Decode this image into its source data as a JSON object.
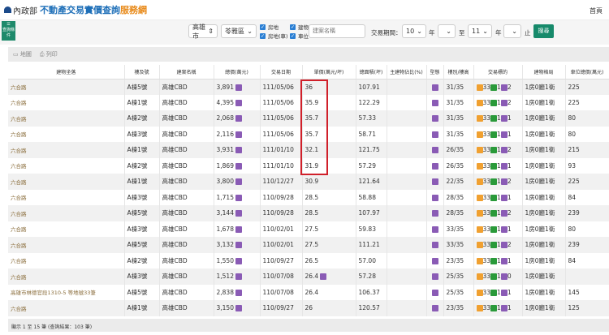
{
  "header": {
    "org": "內政部",
    "title_main": "不動產交易實價查詢",
    "title_accent": "服務網",
    "home": "首頁"
  },
  "filter": {
    "toggle_button": "查詢條件",
    "city": "高雄市",
    "district": "苓雅區",
    "types": [
      "房地",
      "建物",
      "房地(車)",
      "車位"
    ],
    "project_placeholder": "建案名稱",
    "period_label": "交易期間：",
    "from_year": "10",
    "year_label": "年",
    "to_label": "至",
    "to_year": "11",
    "end_label": "止",
    "search_button": "搜尋"
  },
  "toolbar": {
    "map": "地圖",
    "print": "列印"
  },
  "columns": [
    "建物坐落",
    "樓及號",
    "建案名稱",
    "總價(萬元)",
    "交易日期",
    "單價(萬元/坪)",
    "總面積(坪)",
    "主建物佔比(%)",
    "型態",
    "樓別/樓高",
    "交易標的",
    "建物格局",
    "車位總價(萬元)"
  ],
  "rows": [
    [
      "六合路",
      "A棟5號",
      "高雄CBD",
      "3,891",
      "111/05/06",
      "36",
      "107.91",
      "",
      "31/35",
      "33",
      "1",
      "2",
      "1房0廳1衛",
      "225"
    ],
    [
      "六合路",
      "A棟1號",
      "高雄CBD",
      "4,395",
      "111/05/06",
      "35.9",
      "122.29",
      "",
      "31/35",
      "33",
      "1",
      "2",
      "1房0廳1衛",
      "225"
    ],
    [
      "六合路",
      "A棟2號",
      "高雄CBD",
      "2,068",
      "111/05/06",
      "35.7",
      "57.33",
      "",
      "31/35",
      "33",
      "1",
      "1",
      "1房0廳1衛",
      "80"
    ],
    [
      "六合路",
      "A棟3號",
      "高雄CBD",
      "2,116",
      "111/05/06",
      "35.7",
      "58.71",
      "",
      "31/35",
      "33",
      "1",
      "1",
      "1房0廳1衛",
      "80"
    ],
    [
      "六合路",
      "A棟1號",
      "高雄CBD",
      "3,931",
      "111/01/10",
      "32.1",
      "121.75",
      "",
      "26/35",
      "33",
      "1",
      "2",
      "1房0廳1衛",
      "215"
    ],
    [
      "六合路",
      "A棟2號",
      "高雄CBD",
      "1,869",
      "111/01/10",
      "31.9",
      "57.29",
      "",
      "26/35",
      "33",
      "1",
      "1",
      "1房0廳1衛",
      "93"
    ],
    [
      "六合路",
      "A棟1號",
      "高雄CBD",
      "3,800",
      "110/12/27",
      "30.9",
      "121.64",
      "",
      "22/35",
      "33",
      "1",
      "2",
      "1房0廳1衛",
      "225"
    ],
    [
      "六合路",
      "A棟3號",
      "高雄CBD",
      "1,715",
      "110/09/28",
      "28.5",
      "58.88",
      "",
      "28/35",
      "33",
      "1",
      "1",
      "1房0廳1衛",
      "84"
    ],
    [
      "六合路",
      "A棟5號",
      "高雄CBD",
      "3,144",
      "110/09/28",
      "28.5",
      "107.97",
      "",
      "28/35",
      "33",
      "1",
      "2",
      "1房0廳1衛",
      "239"
    ],
    [
      "六合路",
      "A棟3號",
      "高雄CBD",
      "1,678",
      "110/02/01",
      "27.5",
      "59.83",
      "",
      "33/35",
      "33",
      "1",
      "1",
      "1房0廳1衛",
      "80"
    ],
    [
      "六合路",
      "A棟5號",
      "高雄CBD",
      "3,132",
      "110/02/01",
      "27.5",
      "111.21",
      "",
      "33/35",
      "33",
      "1",
      "2",
      "1房0廳1衛",
      "239"
    ],
    [
      "六合路",
      "A棟2號",
      "高雄CBD",
      "1,550",
      "110/09/27",
      "26.5",
      "57.00",
      "",
      "23/35",
      "33",
      "1",
      "1",
      "1房0廳1衛",
      "84"
    ],
    [
      "六合路",
      "A棟3號",
      "高雄CBD",
      "1,512",
      "110/07/08",
      "26.4",
      "57.28",
      "",
      "25/35",
      "33",
      "1",
      "0",
      "1房0廳1衛",
      ""
    ],
    [
      "高雄市林德官段1310-5 等地號33筆",
      "A棟5號",
      "高雄CBD",
      "2,838",
      "110/07/08",
      "26.4",
      "106.37",
      "",
      "25/35",
      "33",
      "1",
      "1",
      "1房0廳1衛",
      "145"
    ],
    [
      "六合路",
      "A棟1號",
      "高雄CBD",
      "3,150",
      "110/09/27",
      "26",
      "120.57",
      "",
      "23/35",
      "33",
      "1",
      "1",
      "1房0廳1衛",
      "125"
    ]
  ],
  "tag_labels": {
    "land": "土",
    "building": "建",
    "parking": "車"
  },
  "colors": {
    "land": "#f0a030",
    "building": "#2a9a3a",
    "parking": "#8a5bb5",
    "highlight": "#d0202a",
    "search": "#178a6b"
  },
  "footer": "顯示 1 至 15 筆 (查詢結果：103 筆)"
}
